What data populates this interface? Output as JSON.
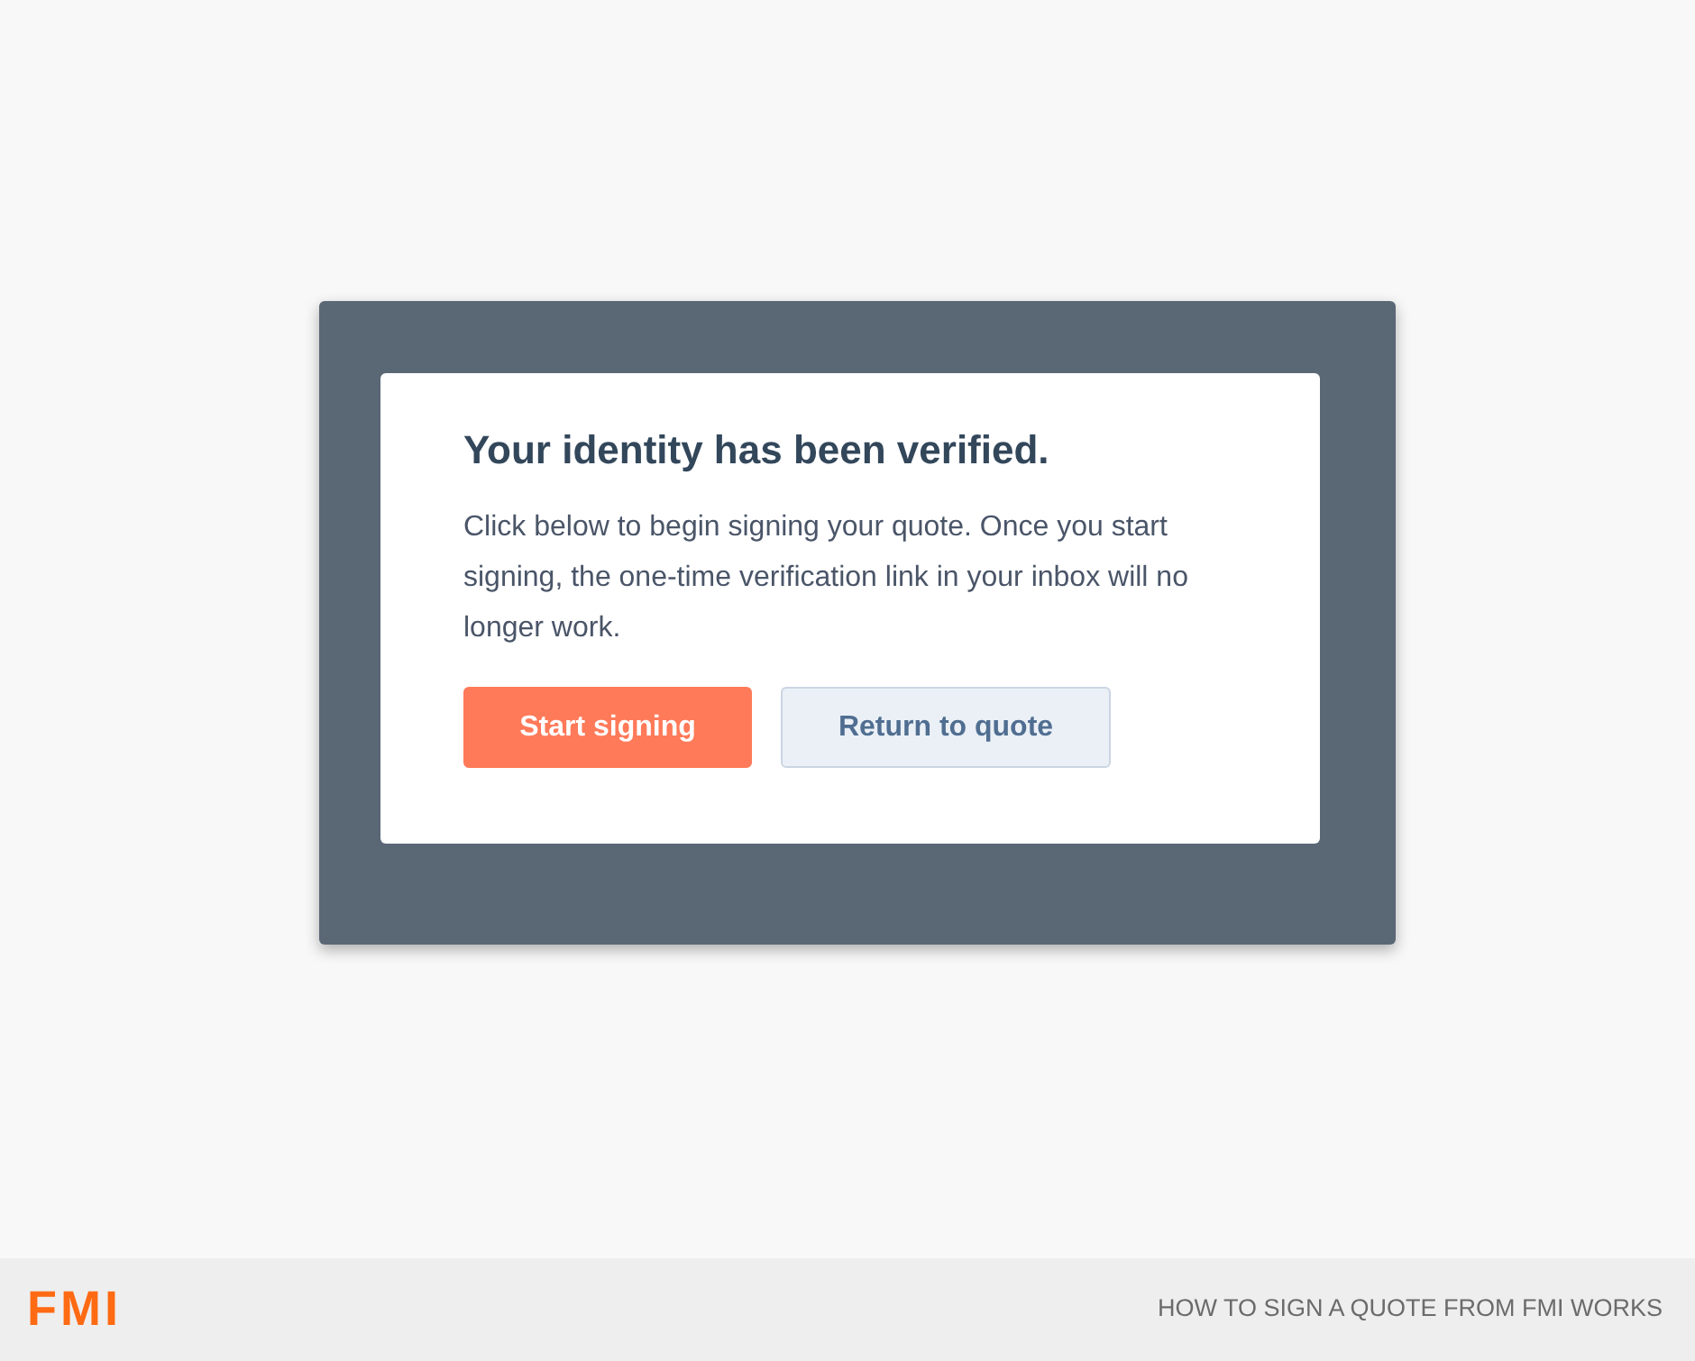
{
  "dialog": {
    "title": "Your identity has been verified.",
    "message": "Click below to begin signing your quote. Once you start signing, the one-time verification link in your inbox will no longer work.",
    "buttons": [
      {
        "label": "Start signing",
        "kind": "primary"
      },
      {
        "label": "Return to quote",
        "kind": "secondary"
      }
    ]
  },
  "footer": {
    "logo": "FMI",
    "caption": "HOW TO SIGN A QUOTE FROM FMI WORKS"
  }
}
